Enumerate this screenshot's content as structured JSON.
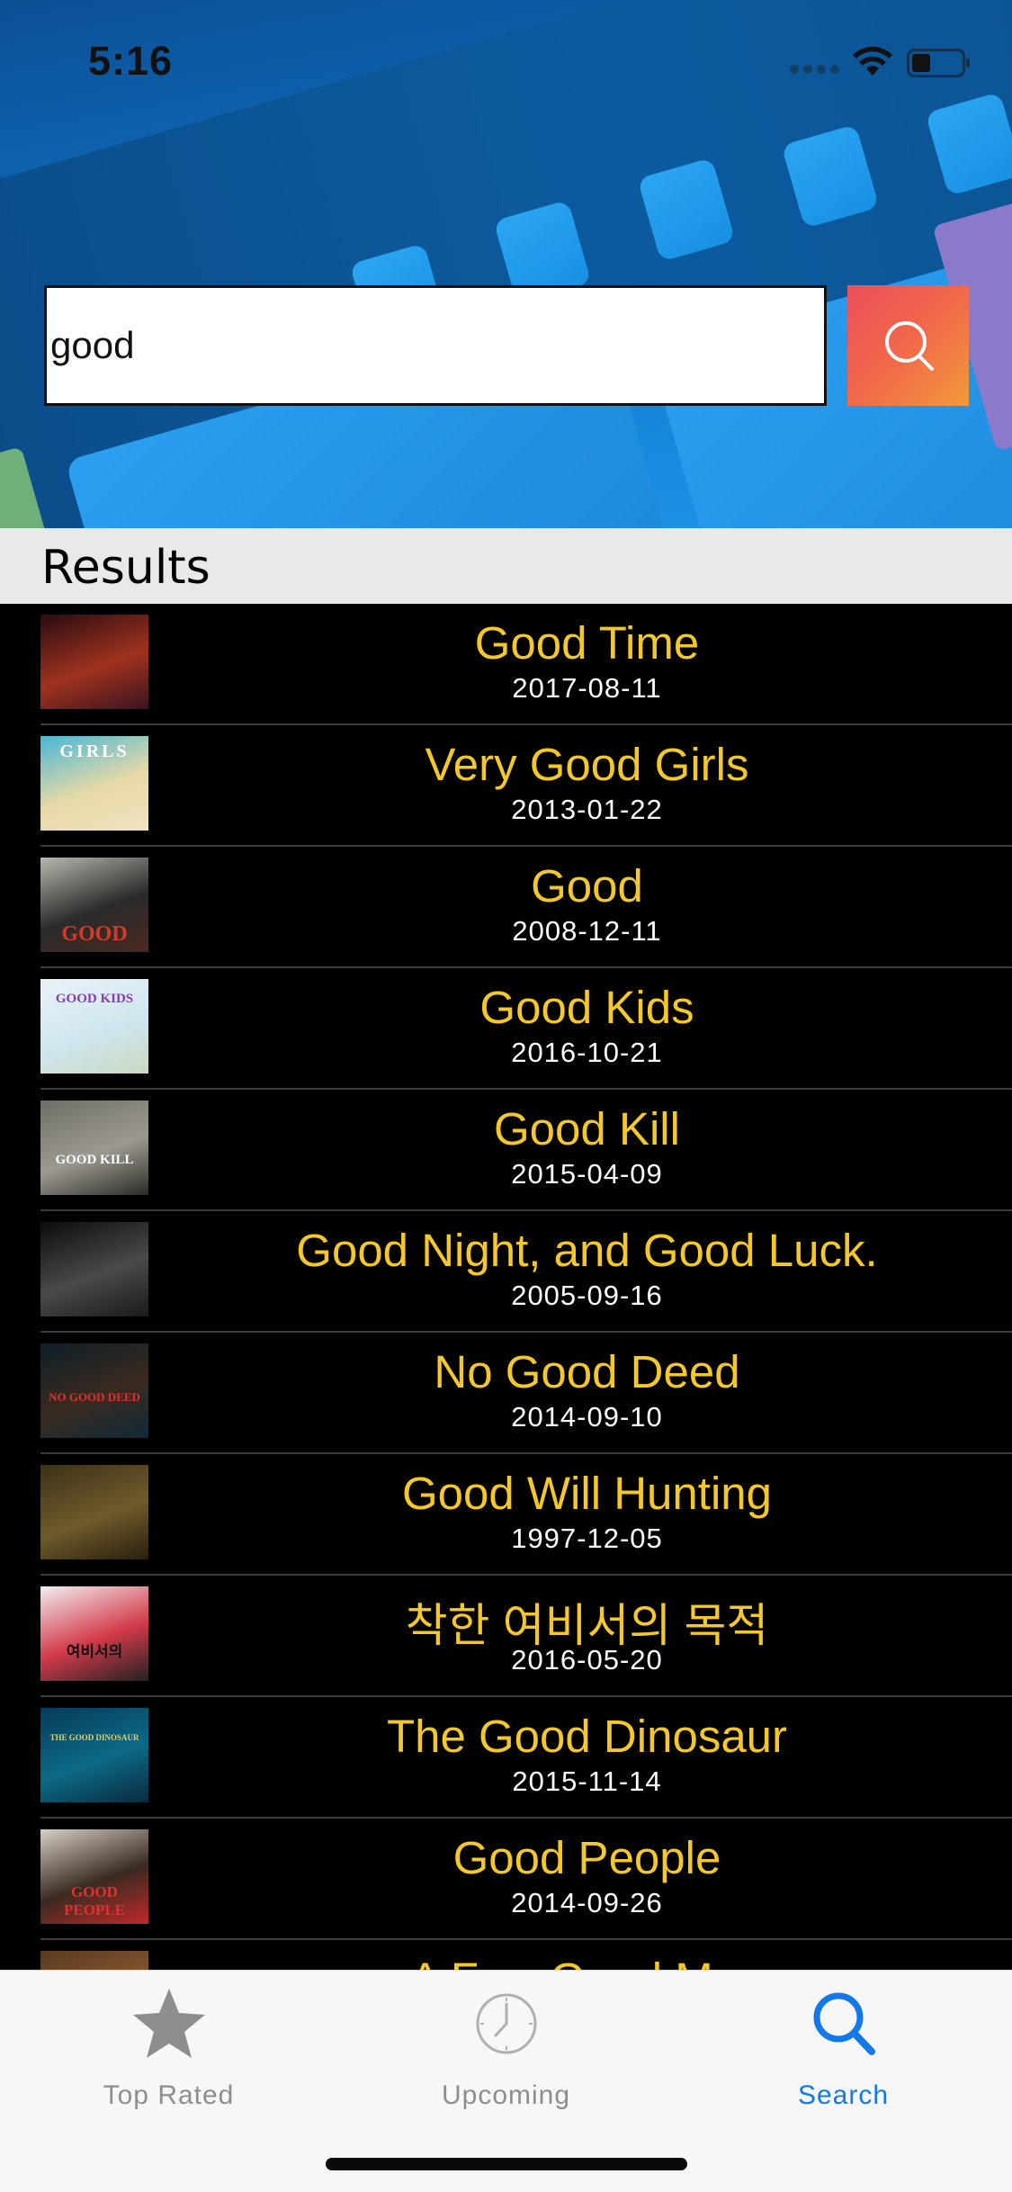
{
  "status_bar": {
    "time": "5:16",
    "icons": [
      "signal-icon",
      "wifi-icon",
      "battery-icon"
    ]
  },
  "search": {
    "value": "good",
    "placeholder": "",
    "button_icon": "search-icon",
    "button_gradient": [
      "#ec4f5a",
      "#f39a3a"
    ]
  },
  "results": {
    "title": "Results",
    "items": [
      {
        "title": "Good Time",
        "date": "2017-08-11",
        "poster_palette": [
          "#2a0c12",
          "#a0321e",
          "#3a1420"
        ],
        "poster_text": ""
      },
      {
        "title": "Very Good Girls",
        "date": "2013-01-22",
        "poster_palette": [
          "#47b7d6",
          "#e7d9a6",
          "#f0e3c0"
        ],
        "poster_text": "GIRLS"
      },
      {
        "title": "Good",
        "date": "2008-12-11",
        "poster_palette": [
          "#b9b7ae",
          "#2a2a2a",
          "#4a2a20"
        ],
        "poster_text": "GOOD"
      },
      {
        "title": "Good Kids",
        "date": "2016-10-21",
        "poster_palette": [
          "#eaf3f7",
          "#cfe6f0",
          "#c9d9c1"
        ],
        "poster_text": "GOOD KIDS"
      },
      {
        "title": "Good Kill",
        "date": "2015-04-09",
        "poster_palette": [
          "#6f6e66",
          "#9c9a90",
          "#2b2a26"
        ],
        "poster_text": "GOOD KILL"
      },
      {
        "title": "Good Night, and Good Luck.",
        "date": "2005-09-16",
        "poster_palette": [
          "#0c0c0c",
          "#4a4a4a",
          "#1a1a1a"
        ],
        "poster_text": ""
      },
      {
        "title": "No Good Deed",
        "date": "2014-09-10",
        "poster_palette": [
          "#0d1f28",
          "#3a2a20",
          "#0f2a38"
        ],
        "poster_text": "NO GOOD DEED"
      },
      {
        "title": "Good Will Hunting",
        "date": "1997-12-05",
        "poster_palette": [
          "#3d3218",
          "#6f5a2a",
          "#2a2010"
        ],
        "poster_text": ""
      },
      {
        "title": "착한 여비서의 목적",
        "date": "2016-05-20",
        "poster_palette": [
          "#f2eeee",
          "#d33a4a",
          "#222"
        ],
        "poster_text": "여비서의"
      },
      {
        "title": "The Good Dinosaur",
        "date": "2015-11-14",
        "poster_palette": [
          "#063a5a",
          "#0c6a86",
          "#0a2a40"
        ],
        "poster_text": "THE GOOD DINOSAUR"
      },
      {
        "title": "Good People",
        "date": "2014-09-26",
        "poster_palette": [
          "#d6d0c4",
          "#3a2a20",
          "#c02a2a"
        ],
        "poster_text": "GOOD PEOPLE"
      },
      {
        "title": "A Few Good Men",
        "date": "",
        "poster_palette": [
          "#5a3a20",
          "#8a5a30",
          "#3a2010"
        ],
        "poster_text": ""
      }
    ]
  },
  "tabs": [
    {
      "label": "Top Rated",
      "icon": "star-icon",
      "active": false
    },
    {
      "label": "Upcoming",
      "icon": "clock-icon",
      "active": false
    },
    {
      "label": "Search",
      "icon": "search-icon",
      "active": true
    }
  ],
  "colors": {
    "title_yellow": "#f4c82a",
    "tab_active_blue": "#1479e8",
    "tab_inactive_gray": "#8e8e8e"
  }
}
